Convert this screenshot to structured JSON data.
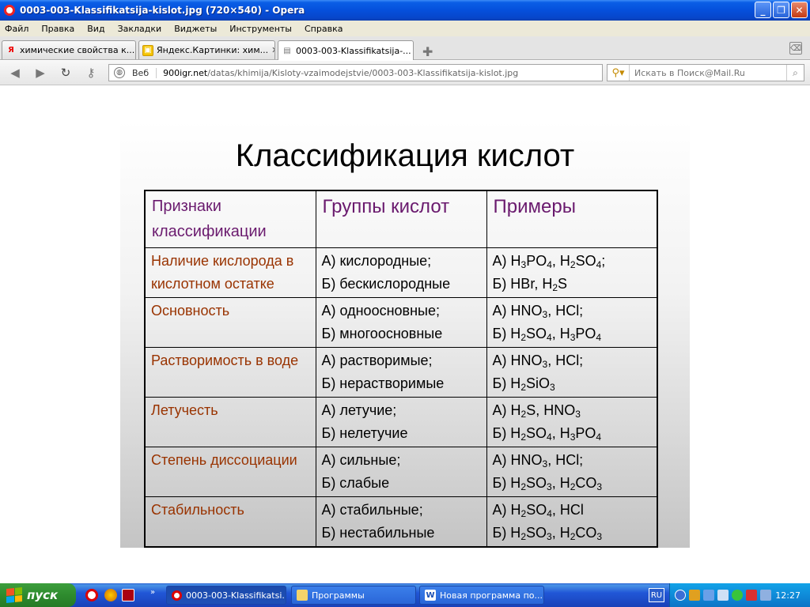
{
  "window": {
    "title": "0003-003-Klassifikatsija-kislot.jpg (720×540) - Opera",
    "controls": {
      "minimize": "_",
      "maximize": "❐",
      "close": "✕"
    }
  },
  "menu": [
    "Файл",
    "Правка",
    "Вид",
    "Закладки",
    "Виджеты",
    "Инструменты",
    "Справка"
  ],
  "tabs": [
    {
      "label": "химические свойства к...",
      "icon": "yandex-icon",
      "close": "✕"
    },
    {
      "label": "Яндекс.Картинки: хим...",
      "icon": "yandex-images-icon",
      "close": "✕"
    },
    {
      "label": "0003-003-Klassifikatsija-...",
      "icon": "image-icon",
      "close": "✕",
      "active": true
    }
  ],
  "address": {
    "mode_label": "Веб",
    "url_domain": "900igr.net",
    "url_path": "/datas/khimija/Kisloty-vzaimodejstvie/0003-003-Klassifikatsija-kislot.jpg"
  },
  "search": {
    "placeholder": "Искать в Поиск@Mail.Ru"
  },
  "slide": {
    "title": "Классификация кислот",
    "headers": [
      "Признаки классификации",
      "Группы кислот",
      "Примеры"
    ],
    "rows": [
      {
        "feature": " Наличие кислорода в кислотном остатке",
        "group_a": "А) кислородные;",
        "group_b": "Б) бескислородные"
      },
      {
        "feature": "Основность",
        "group_a": "А) одноосновные;",
        "group_b": "Б) многоосновные"
      },
      {
        "feature": "Растворимость в воде",
        "group_a": "А) растворимые;",
        "group_b": "Б) нерастворимые"
      },
      {
        "feature": "Летучесть",
        "group_a": "А) летучие;",
        "group_b": "Б) нелетучие"
      },
      {
        "feature": "Степень диссоциации",
        "group_a": "А) сильные;",
        "group_b": "Б) слабые"
      },
      {
        "feature": "Стабильность",
        "group_a": "А) стабильные;",
        "group_b": "Б) нестабильные"
      }
    ],
    "examples": [
      {
        "a_prefix": "А) ",
        "a_html": "H<sub>3</sub>PO<sub>4</sub>, H<sub>2</sub>SO<sub>4</sub>;",
        "b_prefix": "Б) ",
        "b_html": "HBr, H<sub>2</sub>S"
      },
      {
        "a_prefix": "А) ",
        "a_html": "HNO<sub>3</sub>, HCl;",
        "b_prefix": "Б) ",
        "b_html": "H<sub>2</sub>SO<sub>4</sub>, H<sub>3</sub>PO<sub>4</sub>"
      },
      {
        "a_prefix": "А) ",
        "a_html": "HNO<sub>3</sub>, HCl;",
        "b_prefix": "Б) ",
        "b_html": "H<sub>2</sub>SiO<sub>3</sub>"
      },
      {
        "a_prefix": "А) ",
        "a_html": "H<sub>2</sub>S, HNO<sub>3</sub>",
        "b_prefix": "Б) ",
        "b_html": "H<sub>2</sub>SO<sub>4</sub>, H<sub>3</sub>PO<sub>4</sub>"
      },
      {
        "a_prefix": "А) ",
        "a_html": "HNO<sub>3</sub>, HCl;",
        "b_prefix": "Б) ",
        "b_html": "H<sub>2</sub>SO<sub>3</sub>, H<sub>2</sub>CO<sub>3</sub>"
      },
      {
        "a_prefix": "А) ",
        "a_html": "H<sub>2</sub>SO<sub>4</sub>, HCl",
        "b_prefix": "Б) ",
        "b_html": "H<sub>2</sub>SO<sub>3</sub>, H<sub>2</sub>CO<sub>3</sub>"
      }
    ],
    "colors": {
      "header": "#6a1a6e",
      "feature": "#993300"
    }
  },
  "taskbar": {
    "start_label": "пуск",
    "tasks": [
      {
        "label": "0003-003-Klassifikatsi...",
        "icon": "opera-icon",
        "active": true
      },
      {
        "label": "Программы",
        "icon": "folder-icon"
      },
      {
        "label": "Новая программа по...",
        "icon": "word-icon"
      }
    ],
    "language": "RU",
    "clock": "12:27"
  }
}
